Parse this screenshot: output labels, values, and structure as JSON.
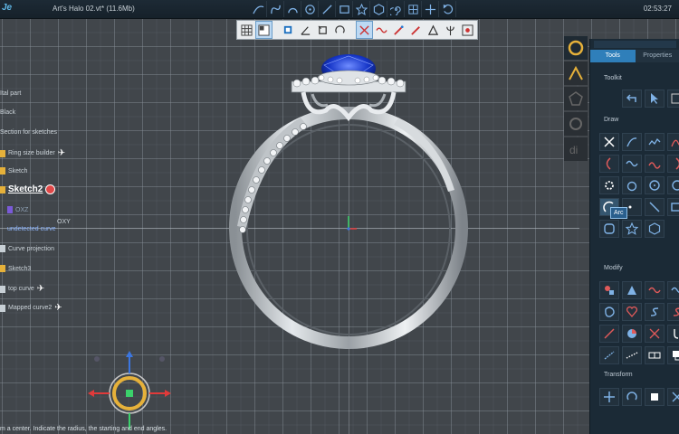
{
  "app": {
    "logo": "Je"
  },
  "window": {
    "title": "Art's Halo 02.vt* (11.6Mb)",
    "clock": "02:53:27"
  },
  "top_toolbar": {
    "icons": [
      "curve-icon",
      "spline-icon",
      "arc-tool-icon",
      "circle-target-icon",
      "line-icon",
      "rectangle-icon",
      "star-icon",
      "hexagon-icon",
      "spiral-icon",
      "grid-snap-icon",
      "move-icon",
      "undo-arc-icon"
    ]
  },
  "sub_toolbar": {
    "icons": [
      "grid-view-icon",
      "panel-view-icon",
      "cube-view-icon",
      "angle-icon",
      "square-select-icon",
      "rotate-icon",
      "cut-tool-icon",
      "snake-tool-icon",
      "pen-tool-icon",
      "brush-tool-icon",
      "triangle-icon",
      "trident-icon",
      "record-icon"
    ]
  },
  "tree": {
    "items": [
      {
        "label": "Ital part",
        "style": "normal"
      },
      {
        "label": "Black",
        "style": "normal"
      },
      {
        "label": "Section for sketches",
        "style": "normal"
      },
      {
        "label": "Ring size builder",
        "style": "normal"
      },
      {
        "label": "Sketch",
        "style": "normal"
      },
      {
        "label": "Sketch2",
        "style": "bold"
      },
      {
        "label": "OXZ",
        "style": "dim"
      },
      {
        "label": "undetected curve",
        "style": "blue"
      },
      {
        "label": "Curve projection",
        "style": "normal"
      },
      {
        "label": "Sketch3",
        "style": "normal"
      },
      {
        "label": "top curve",
        "style": "normal"
      },
      {
        "label": "Mapped curve2",
        "style": "normal"
      }
    ],
    "axis_label": "OXY"
  },
  "status_bar": {
    "text": "m a center. Indicate the radius, the starting and end angles."
  },
  "right_panel": {
    "tabs": [
      "Tools",
      "Properties"
    ],
    "active_tab": "Tools",
    "sections": [
      "Toolkit",
      "Draw",
      "Modify",
      "Transform"
    ],
    "tooltip": "Arc"
  },
  "colors": {
    "accent": "#2f7fba",
    "gem": "#1636c8",
    "ring_metal": "#c9ced2",
    "gizmo_gold": "#e6b13a"
  }
}
